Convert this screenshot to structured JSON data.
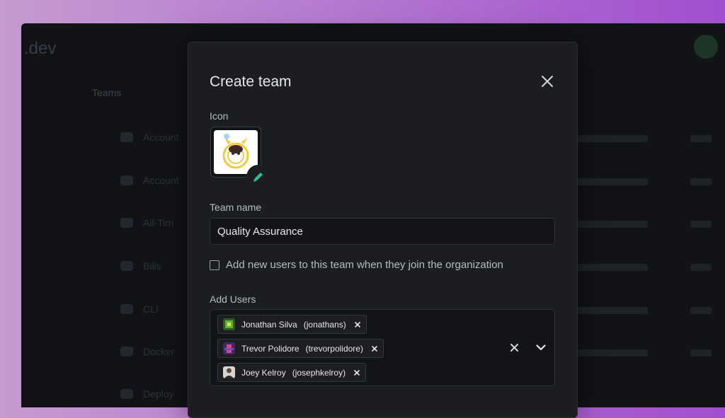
{
  "background": {
    "logo": ".dev",
    "heading": "Teams",
    "rows": [
      "Account",
      "Account",
      "All-Tim",
      "Bills",
      "CLI",
      "Docker",
      "Deploy"
    ]
  },
  "modal": {
    "title": "Create team",
    "icon_label": "Icon",
    "team_name_label": "Team name",
    "team_name_value": "Quality Assurance",
    "checkbox_label": "Add new users to this team when they join the organization",
    "checkbox_checked": false,
    "add_users_label": "Add Users",
    "users": [
      {
        "name": "Jonathan Silva",
        "username": "(jonathans)",
        "avatar_color": "#5db33a"
      },
      {
        "name": "Trevor Polidore",
        "username": "(trevorpolidore)",
        "avatar_color": "#7d49b8"
      },
      {
        "name": "Joey Kelroy",
        "username": "(josephkelroy)",
        "avatar_color": "#d9d4cf"
      }
    ]
  },
  "colors": {
    "accent_green": "#2dbf8e",
    "modal_bg": "#1b1d21",
    "outer_gradient_start": "#c69ad0",
    "outer_gradient_end": "#a14fcf"
  },
  "icons": {
    "close": "close-icon",
    "edit": "pencil-icon",
    "chip_remove": "close-small-icon",
    "clear_all": "close-icon",
    "dropdown": "chevron-down-icon"
  }
}
